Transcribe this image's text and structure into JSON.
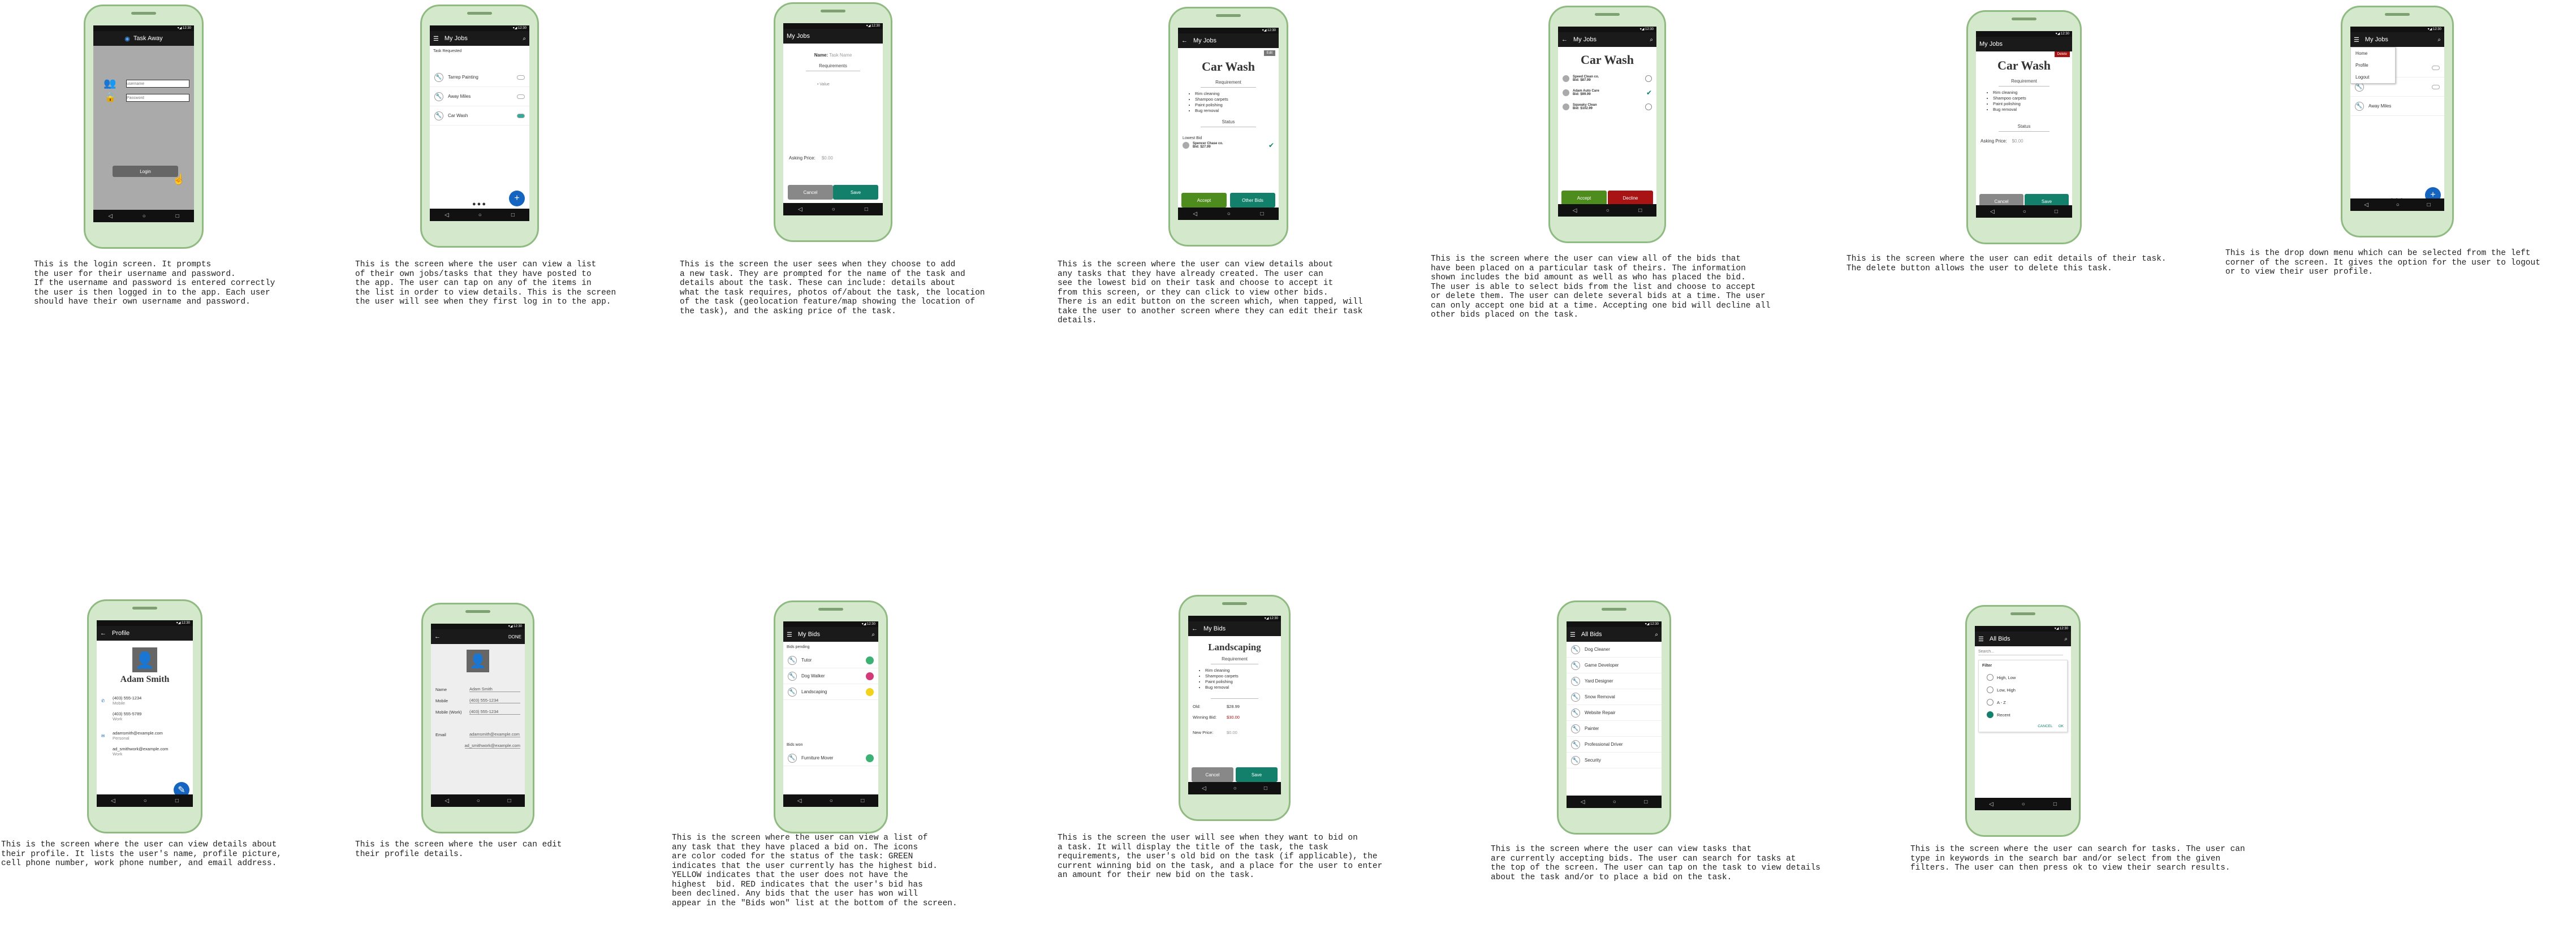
{
  "colors": {
    "phone": "#d4e8cc",
    "green": "#4e8d1d",
    "teal": "#12806b",
    "red": "#a81414",
    "blue": "#1565c0",
    "gray": "#888888"
  },
  "login": {
    "app_title": "Task Away",
    "username_ph": "username",
    "password_ph": "Password",
    "login": "Login",
    "caption": "This is the login screen. It prompts\nthe user for their username and password.\nIf the username and password is entered correctly\nthe user is then logged in to the app. Each user\nshould have their own username and password."
  },
  "myjobs": {
    "title": "My Jobs",
    "section": "Task Requested",
    "items": [
      "Tarrep Painting",
      "Away Miles",
      "Car Wash"
    ],
    "caption": "This is the screen where the user can view a list\nof their own jobs/tasks that they have posted to\nthe app. The user can tap on any of the items in\nthe list in order to view details. This is the screen\nthe user will see when they first log in to the app."
  },
  "addtask": {
    "title": "My Jobs",
    "name_label": "Name:",
    "name_val": "Task Name",
    "req": "Requirements",
    "bullet": "Value",
    "asking": "Asking Price:",
    "price": "$0.00",
    "cancel": "Cancel",
    "save": "Save",
    "caption": "This is the screen the user sees when they choose to add\na new task. They are prompted for the name of the task and\ndetails about the task. These can include: details about\nwhat the task requires, photos of/about the task, the location\nof the task (geolocation feature/map showing the location of\nthe task), and the asking price of the task."
  },
  "viewtask": {
    "title": "My Jobs",
    "edit": "Edit",
    "name": "Car Wash",
    "req": "Requirement",
    "items": [
      "Rim cleaning",
      "Shampoo carpets",
      "Paint polishing",
      "Bug removal"
    ],
    "status": "Status",
    "lowest": "Lowest Bid",
    "bidder": "Spencer Chase co.",
    "bid": "Bid: $27.99",
    "accept": "Accept",
    "other": "Other Bids",
    "caption": "This is the screen where the user can view details about\nany tasks that they have already created. The user can\nsee the lowest bid on their task and choose to accept it\nfrom this screen, or they can click to view other bids.\nThere is an edit button on the screen which, when tapped, will\ntake the user to another screen where they can edit their task\ndetails."
  },
  "bids": {
    "title": "My Jobs",
    "name": "Car Wash",
    "list": [
      {
        "n": "Speed Clean co.",
        "b": "Bid: $87.99"
      },
      {
        "n": "Adam Auto Care",
        "b": "Bid: $99.99"
      },
      {
        "n": "Squeaky Clean",
        "b": "Bid: $102.99"
      }
    ],
    "accept": "Accept",
    "decline": "Decline",
    "caption": "This is the screen where the user can view all of the bids that\nhave been placed on a particular task of theirs. The information\nshown includes the bid amount as well as who has placed the bid.\nThe user is able to select bids from the list and choose to accept\nor delete them. The user can delete several bids at a time. The user\ncan only accept one bid at a time. Accepting one bid will decline all\nother bids placed on the task."
  },
  "edittask": {
    "title": "My Jobs",
    "delete": "Delete",
    "name": "Car Wash",
    "req": "Requirement",
    "items": [
      "Rim cleaning",
      "Shampoo carpets",
      "Paint polishing",
      "Bug removal"
    ],
    "status": "Status",
    "asking": "Asking Price:",
    "price": "$0.00",
    "cancel": "Cancel",
    "save": "Save",
    "caption": "This is the screen where the user can edit details of their task.\nThe delete button allows the user to delete this task."
  },
  "dropdown": {
    "title": "My Jobs",
    "menu": [
      "Home",
      "Profile",
      "Logout"
    ],
    "items": [
      "",
      "",
      "",
      "Away Miles"
    ],
    "caption": "This is the drop down menu which can be selected from the left\ncorner of the screen. It gives the option for the user to logout\nor to view their user profile."
  },
  "profile": {
    "title": "Profile",
    "name": "Adam Smith",
    "rows": [
      {
        "v": "(403) 555-1234",
        "l": "Mobile"
      },
      {
        "v": "(403) 555-5789",
        "l": "Work"
      },
      {
        "v": "adamsmith@example.com",
        "l": "Personal"
      },
      {
        "v": "ad_smithwork@example.com",
        "l": "Work"
      }
    ],
    "caption": "This is the screen where the user can view details about\ntheir profile. It lists the user's name, profile picture,\ncell phone number, work phone number, and email address."
  },
  "editprofile": {
    "done": "DONE",
    "labels": [
      "Name",
      "Mobile",
      "Mobile (Work)",
      "Email",
      ""
    ],
    "vals": [
      "Adam Smith",
      "(403) 555-1234",
      "(403) 555-1234",
      "adamsmith@example.com",
      "ad_smithwork@example.com"
    ],
    "caption": "This is the screen where the user can edit\ntheir profile details."
  },
  "mybids": {
    "title": "My Bids",
    "pending": "Bids pending",
    "items": [
      "Tutor",
      "Dog Walker",
      "Landscaping"
    ],
    "won": "Bids won",
    "won_item": "Furniture Mover",
    "caption": "This is the screen where the user can view a list of\nany task that they have placed a bid on. The icons\nare color coded for the status of the task: GREEN\nindicates that the user currently has the highest bid.\nYELLOW indicates that the user does not have the\nhighest  bid. RED indicates that the user's bid has\nbeen declined. Any bids that the user has won will\nappear in the \"Bids won\" list at the bottom of the screen."
  },
  "placebid": {
    "title": "My Bids",
    "name": "Landscaping",
    "req": "Requirement",
    "items": [
      "Rim cleaning",
      "Shampoo carpets",
      "Paint polishing",
      "Bug removal"
    ],
    "old": "Old:",
    "old_val": "$28.99",
    "winning": "Winning Bid:",
    "winning_val": "$30.00",
    "new": "New Price:",
    "new_val": "$0.00",
    "cancel": "Cancel",
    "save": "Save",
    "caption": "This is the screen the user will see when they want to bid on\na task. It will display the title of the task, the task\nrequirements, the user's old bid on the task (if applicable), the\ncurrent winning bid on the task, and a place for the user to enter\nan amount for their new bid on the task."
  },
  "allbids": {
    "title": "All Bids",
    "items": [
      "Dog Cleaner",
      "Game Developer",
      "Yard Designer",
      "Snow Removal",
      "Website Repair",
      "Painter",
      "Professional Driver",
      "Security"
    ],
    "caption": "This is the screen where the user can view tasks that\nare currently accepting bids. The user can search for tasks at\nthe top of the screen. The user can tap on the task to view details\nabout the task and/or to place a bid on the task."
  },
  "search": {
    "title": "All Bids",
    "search_ph": "Search...",
    "filter": "Filter",
    "options": [
      "High, Low",
      "Low, High",
      "A - Z",
      "Recent"
    ],
    "cancel": "CANCEL",
    "ok": "OK",
    "caption": "This is the screen where the user can search for tasks. The user can\ntype in keywords in the search bar and/or select from the given\nfilters. The user can then press ok to view their search results."
  }
}
